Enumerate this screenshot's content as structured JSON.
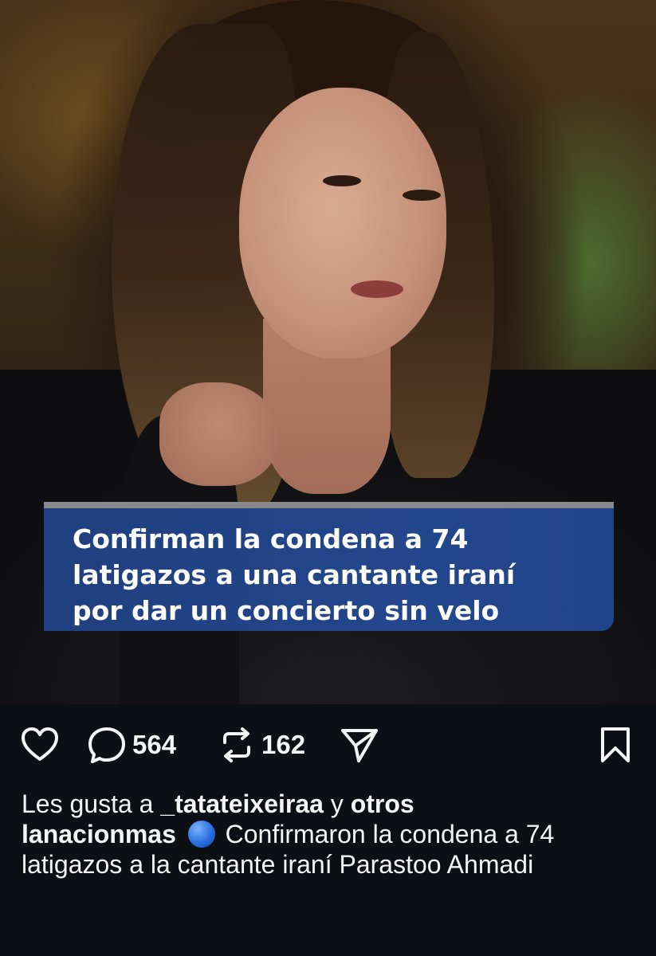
{
  "post": {
    "image_headline": "Confirman la condena a 74\nlatigazos a una cantante iraní\npor dar un concierto sin velo",
    "image_alt": "woman-portrait-photo"
  },
  "actions": {
    "comments_count": "564",
    "reposts_count": "162",
    "icons": [
      "heart-icon",
      "comment-icon",
      "repost-icon",
      "share-icon",
      "bookmark-icon"
    ]
  },
  "likes": {
    "prefix": "Les gusta a",
    "user": "_tatateixeiraa",
    "connector": "y",
    "others": "otros"
  },
  "caption": {
    "author": "lanacionmas",
    "emoji": "blue-circle",
    "text": "Confirmaron la condena a 74 latigazos a la cantante iraní Parastoo Ahmadi"
  },
  "colors": {
    "background": "#0c1014",
    "headline_bg": "#23468c",
    "text": "#f5f5f5"
  }
}
